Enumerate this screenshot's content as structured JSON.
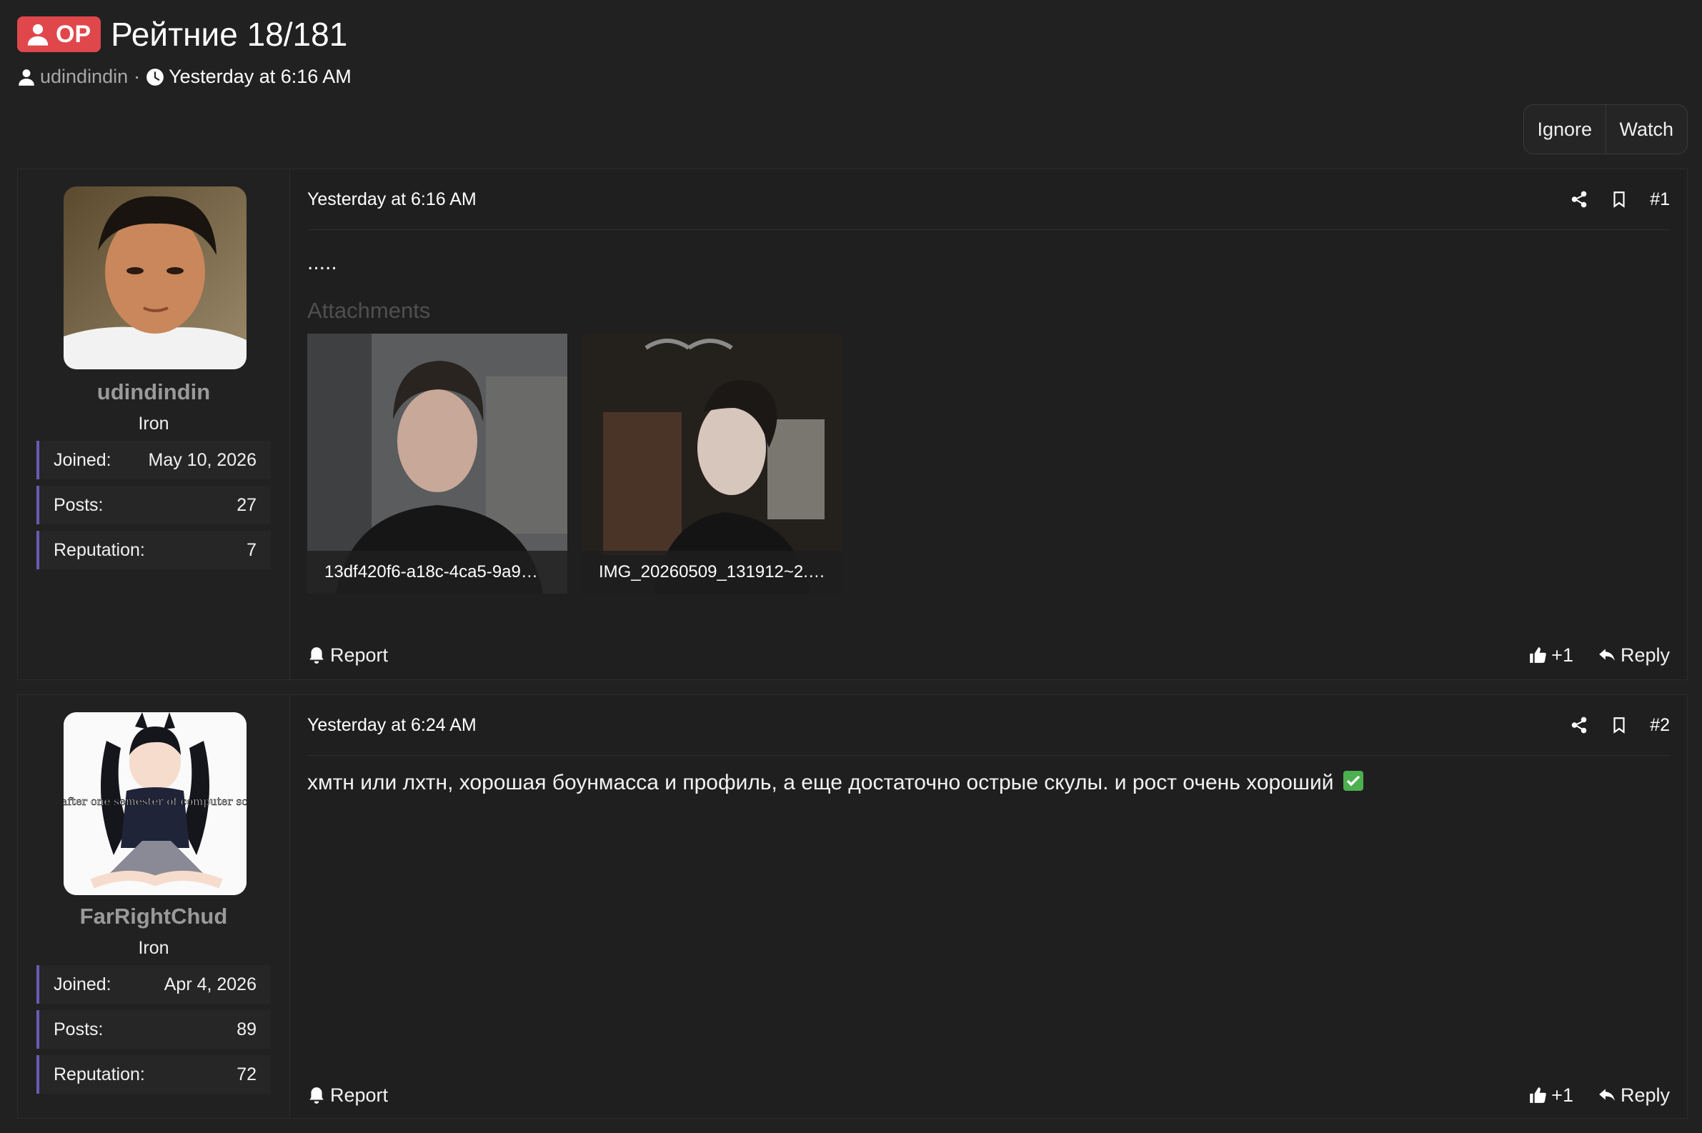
{
  "thread": {
    "badge": "OP",
    "title": "Рейтние 18/181",
    "author": "udindindin",
    "separator": "·",
    "time": "Yesterday at 6:16 AM",
    "actions": {
      "ignore": "Ignore",
      "watch": "Watch"
    }
  },
  "posts": [
    {
      "user": {
        "name": "udindindin",
        "rank": "Iron"
      },
      "stats": [
        {
          "label": "Joined:",
          "value": "May 10, 2026"
        },
        {
          "label": "Posts:",
          "value": "27"
        },
        {
          "label": "Reputation:",
          "value": "7"
        }
      ],
      "time": "Yesterday at 6:16 AM",
      "number": "#1",
      "body": ".....",
      "attachments_label": "Attachments",
      "attachments": [
        {
          "name": "13df420f6-a18c-4ca5-9a9…"
        },
        {
          "name": "IMG_20260509_131912~2.…"
        }
      ],
      "report": "Report",
      "like": "+1",
      "reply": "Reply"
    },
    {
      "user": {
        "name": "FarRightChud",
        "rank": "Iron",
        "avatar_text": "Men after one semester of computer science"
      },
      "stats": [
        {
          "label": "Joined:",
          "value": "Apr 4, 2026"
        },
        {
          "label": "Posts:",
          "value": "89"
        },
        {
          "label": "Reputation:",
          "value": "72"
        }
      ],
      "time": "Yesterday at 6:24 AM",
      "number": "#2",
      "body": "хмтн или лхтн, хорошая боунмасса и профиль, а еще достаточно острые скулы. и рост очень хороший",
      "emoji": "check-mark-button",
      "report": "Report",
      "like": "+1",
      "reply": "Reply"
    }
  ],
  "colors": {
    "op_badge": "#e0474b",
    "stat_accent": "#6a5bb5",
    "background": "#212121"
  }
}
